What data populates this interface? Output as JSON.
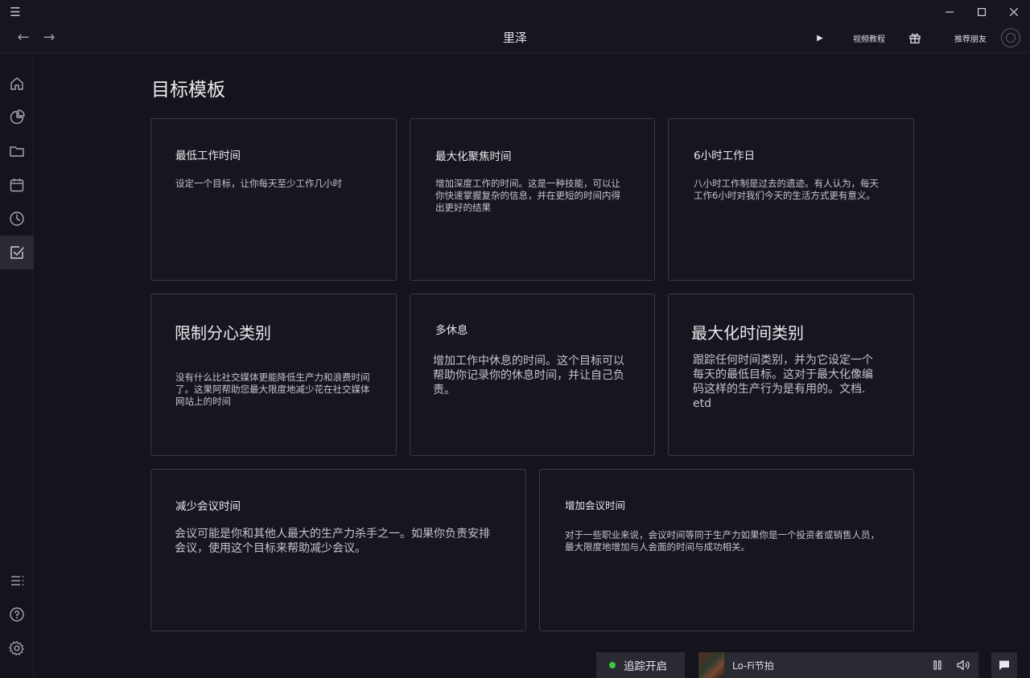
{
  "app": {
    "title": "里泽"
  },
  "titlebar": {
    "menu_icon": "hamburger-icon"
  },
  "nav": {
    "back_icon": "arrow-left-icon",
    "forward_icon": "arrow-right-icon",
    "video_tutorial": "视频教程",
    "recommend_friend": "推荐朋友"
  },
  "sidebar": {
    "items": [
      {
        "icon": "home-icon"
      },
      {
        "icon": "pie-chart-icon"
      },
      {
        "icon": "folder-icon"
      },
      {
        "icon": "calendar-icon"
      },
      {
        "icon": "clock-icon"
      },
      {
        "icon": "checkbox-icon",
        "active": true
      }
    ],
    "bottom": [
      {
        "icon": "list-icon"
      },
      {
        "icon": "help-icon"
      },
      {
        "icon": "settings-icon"
      }
    ]
  },
  "main": {
    "page_title": "目标模板",
    "templates": [
      {
        "title": "最低工作时间",
        "desc": "设定一个目标，让你每天至少工作几小时"
      },
      {
        "title": "最大化聚焦时间",
        "desc": "增加深度工作的时间。这是一种技能，可以让你快速掌握复杂的信息，并在更短的时间内得出更好的结果"
      },
      {
        "title": "6小时工作日",
        "desc": "八小时工作制是过去的遗迹。有人认为，每天工作6小时对我们今天的生活方式更有意义。"
      },
      {
        "title": "限制分心类别",
        "desc": "没有什么比社交媒体更能降低生产力和浪费时间了。这果阿帮助您最大限度地减少花在社交媒体网站上的时间"
      },
      {
        "title": "多休息",
        "desc": "增加工作中休息的时间。这个目标可以帮助你记录你的休息时间，并让自己负责。"
      },
      {
        "title": "最大化时间类别",
        "desc": "跟踪任何时间类别，并为它设定一个每天的最低目标。这对于最大化像编码这样的生产行为是有用的。文档. etd"
      },
      {
        "title": "减少会议时间",
        "desc": "会议可能是你和其他人最大的生产力杀手之一。如果你负责安排会议，使用这个目标来帮助减少会议。"
      },
      {
        "title": "增加会议时间",
        "desc": "对于一些职业来说，会议时间等同于生产力如果你是一个投资者或销售人员，最大限度地增加与人会面的时间与成功相关。"
      }
    ]
  },
  "bottom_bar": {
    "tracking_label": "追踪开启",
    "tracking_status_color": "#3cc83c",
    "track_name": "Lo-Fi节拍"
  }
}
